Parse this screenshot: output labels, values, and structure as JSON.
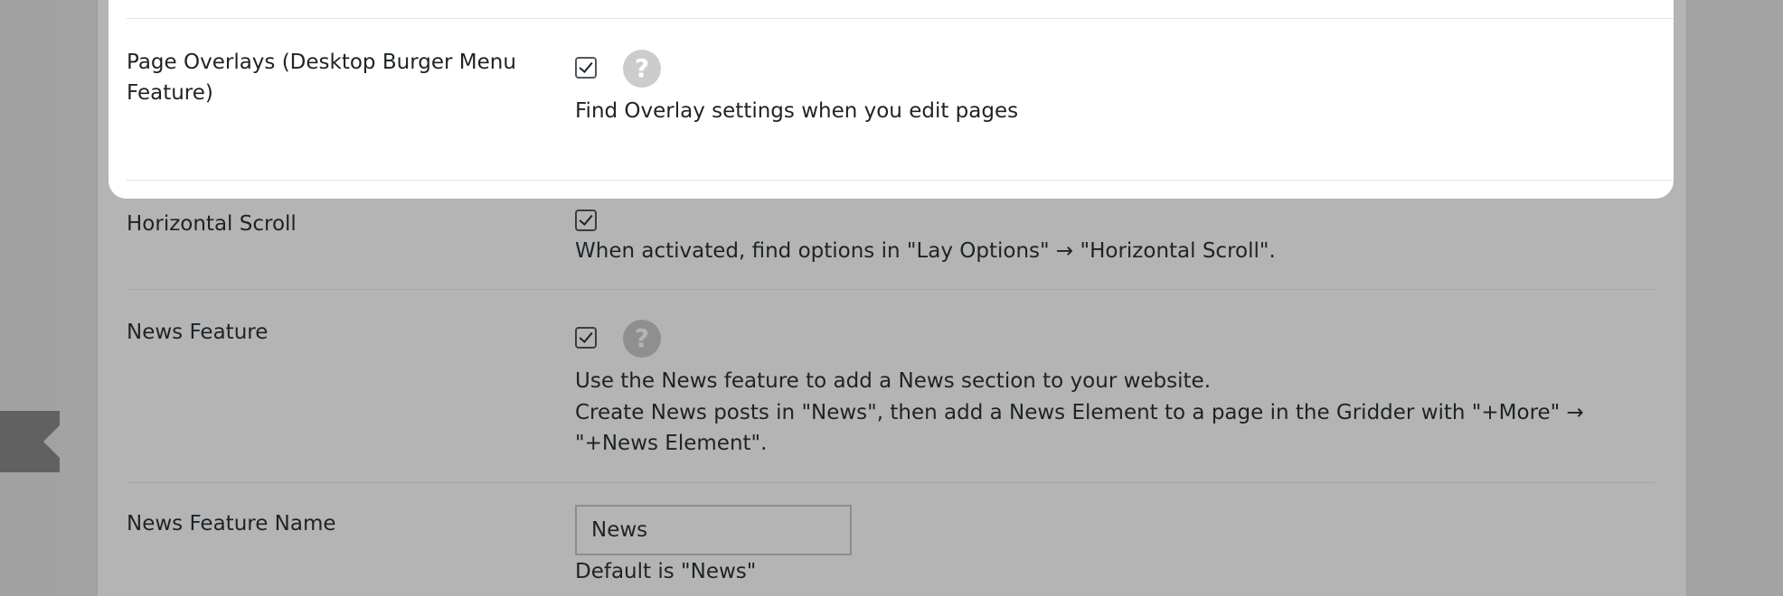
{
  "settings": {
    "page_overlays": {
      "label": "Page Overlays (Desktop Burger Menu Feature)",
      "checked": true,
      "help_icon": "?",
      "description": "Find Overlay settings when you edit pages"
    },
    "horizontal_scroll": {
      "label": "Horizontal Scroll",
      "checked": true,
      "description": "When activated, find options in \"Lay Options\" → \"Horizontal Scroll\"."
    },
    "news_feature": {
      "label": "News Feature",
      "checked": true,
      "help_icon": "?",
      "description_line1": "Use the News feature to add a News section to your website.",
      "description_line2": "Create News posts in \"News\", then add a News Element to a page in the Gridder with \"+More\" →",
      "description_line3": "\"+News Element\"."
    },
    "news_feature_name": {
      "label": "News Feature Name",
      "value": "News",
      "hint": "Default is \"News\""
    }
  },
  "icons": {
    "help": "question-circle-icon",
    "checkbox": "checkmark-icon",
    "sidebar_toggle": "caret-left-icon"
  },
  "colors": {
    "overlay_background": "#b4b4b4",
    "highlight_background": "#ffffff",
    "text": "#1d2327"
  }
}
